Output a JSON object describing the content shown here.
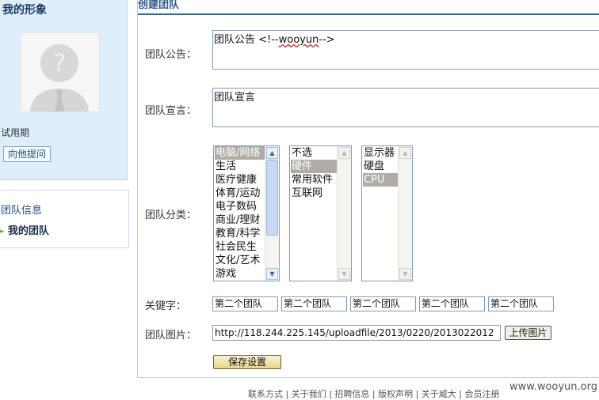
{
  "sidebar": {
    "profile_title": "我的形象",
    "status_text": "试用期",
    "ask_button": "向他提问",
    "menu": [
      {
        "label": "团队信息"
      },
      {
        "label": "我的团队"
      }
    ]
  },
  "panel": {
    "title": "创建团队"
  },
  "form": {
    "announcement_label": "团队公告：",
    "announcement_value": "团队公告 <!--",
    "announcement_value_wavy": "wooyun",
    "announcement_value_tail": "-->",
    "declaration_label": "团队宣言：",
    "declaration_value": "团队宣言",
    "category_label": "团队分类：",
    "category_list1": [
      "电脑/网络",
      "生活",
      "医疗健康",
      "体育/运动",
      "电子数码",
      "商业/理财",
      "教育/科学",
      "社会民生",
      "文化/艺术",
      "游戏"
    ],
    "category_list2": [
      "不选",
      "硬件",
      "常用软件",
      "互联网"
    ],
    "category_list3": [
      "显示器",
      "硬盘",
      "CPU"
    ],
    "keywords_label": "关键字：",
    "keywords": [
      "第二个团队",
      "第二个团队",
      "第二个团队",
      "第二个团队",
      "第二个团队"
    ],
    "image_label": "团队图片：",
    "image_value": "http://118.244.225.145/uploadfile/2013/0220/2013022012",
    "upload_button": "上传图片",
    "save_button": "保存设置"
  },
  "footer": {
    "links_text": "联系方式 | 关于我们 | 招聘信息 | 版权声明 | 关于威大 | 会员注册"
  },
  "watermark": "www.wooyun.org",
  "colors": {
    "panel_border": "#2f6f95",
    "sidebar_bg": "#dfeefb",
    "selection": "#b0aba5"
  }
}
